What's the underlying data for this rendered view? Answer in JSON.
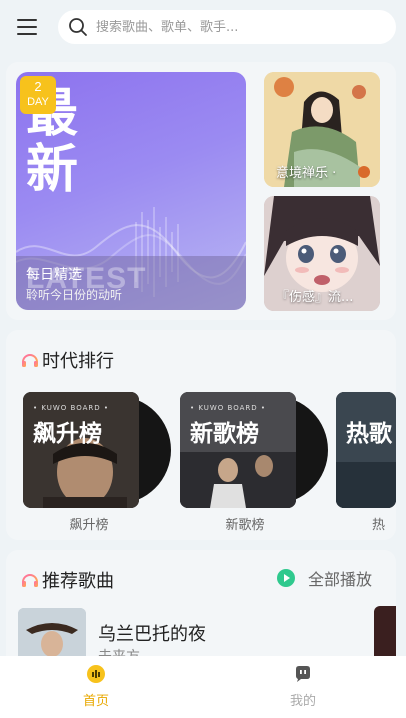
{
  "search": {
    "placeholder": "搜索歌曲、歌单、歌手..."
  },
  "icons": {
    "menu": "menu-icon",
    "search": "search-icon",
    "headphone": "headphone-icon",
    "play": "play-circle-icon",
    "home": "home-icon",
    "mine": "mine-icon"
  },
  "colors": {
    "accent_yellow": "#f7c21c",
    "play_green": "#2fc98e",
    "nav_active": "#e9a800"
  },
  "banner": {
    "daily": {
      "badge_number": "2",
      "badge_unit": "DAY",
      "big_line1": "最",
      "big_line2": "新",
      "watermark": "LATEST",
      "title": "每日精选",
      "subtitle": "聆听今日份的动听"
    },
    "cards": [
      {
        "caption": "意境禅乐 · "
      },
      {
        "caption": "『伤感』流..."
      }
    ]
  },
  "rank": {
    "title": "时代排行",
    "brand": "• KUWO BOARD •",
    "items": [
      {
        "cover_text": "飙升榜",
        "label": "飙升榜"
      },
      {
        "cover_text": "新歌榜",
        "label": "新歌榜"
      },
      {
        "cover_text": "热歌",
        "label": "热"
      }
    ]
  },
  "recommend": {
    "title": "推荐歌曲",
    "play_all": "全部播放",
    "songs": [
      {
        "title": "乌兰巴托的夜",
        "artist": "未来方"
      }
    ]
  },
  "nav": {
    "home": "首页",
    "mine": "我的"
  }
}
